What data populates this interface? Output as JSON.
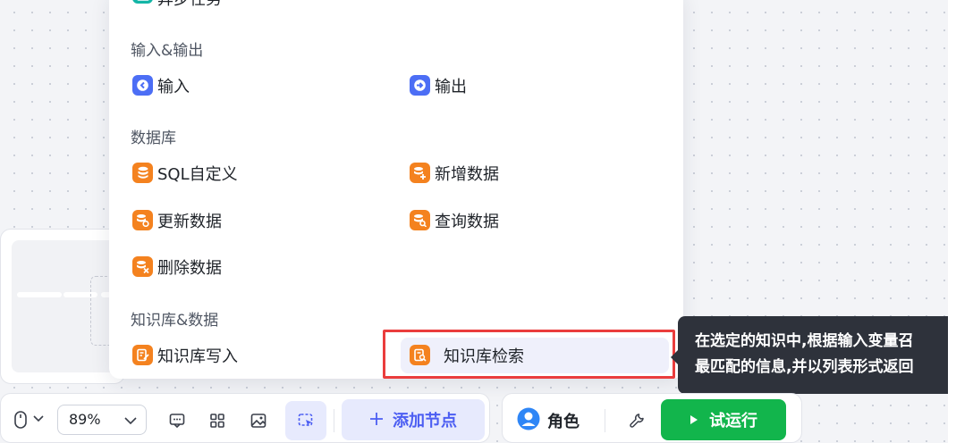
{
  "node_menu": {
    "partial_item": {
      "label": "异步任务",
      "icon": "async-task-icon"
    },
    "groups": [
      {
        "title": "输入&输出",
        "items": [
          {
            "label": "输入",
            "icon": "input-arrow-icon",
            "color": "#4c6ef5"
          },
          {
            "label": "输出",
            "icon": "output-arrow-icon",
            "color": "#4c6ef5"
          }
        ]
      },
      {
        "title": "数据库",
        "items": [
          {
            "label": "SQL自定义",
            "icon": "database-icon",
            "color": "#f4821f"
          },
          {
            "label": "新增数据",
            "icon": "database-add-icon",
            "color": "#f4821f"
          },
          {
            "label": "更新数据",
            "icon": "database-update-icon",
            "color": "#f4821f"
          },
          {
            "label": "查询数据",
            "icon": "database-query-icon",
            "color": "#f4821f"
          },
          {
            "label": "删除数据",
            "icon": "database-delete-icon",
            "color": "#f4821f"
          }
        ]
      },
      {
        "title": "知识库&数据",
        "items": [
          {
            "label": "知识库写入",
            "icon": "knowledge-write-icon",
            "color": "#f4821f"
          },
          {
            "label": "知识库检索",
            "icon": "knowledge-search-icon",
            "color": "#f4821f",
            "hovered": true
          }
        ]
      }
    ]
  },
  "tooltip": {
    "line1": "在选定的知识中,根据输入变量召",
    "line2": "最匹配的信息,并以列表形式返回"
  },
  "toolbar": {
    "zoom": "89%",
    "add_node": "添加节点",
    "add_icon": "plus-icon",
    "role": "角色",
    "run": "试运行"
  },
  "colors": {
    "accent": "#4c5ef2",
    "run_green": "#12b54c",
    "highlight_red": "#ea3d3d",
    "orange": "#f4821f"
  }
}
